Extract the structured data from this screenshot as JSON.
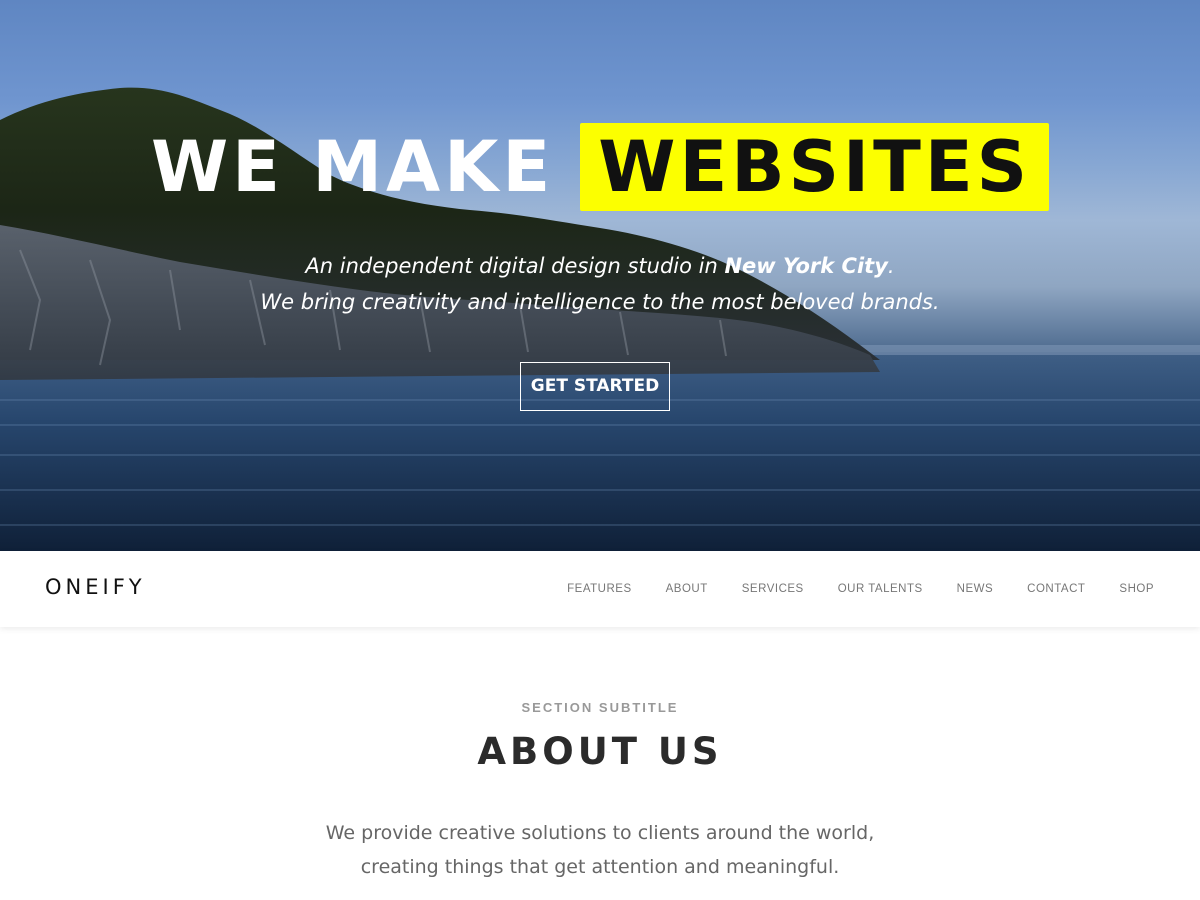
{
  "hero": {
    "headline_white": "WE MAKE",
    "headline_highlight": "WEBSITES",
    "highlight_color": "#fcff00",
    "tagline_line1_prefix": "An independent digital design studio in ",
    "tagline_line1_bold": "New York City",
    "tagline_line1_suffix": ".",
    "tagline_line2": "We bring creativity and intelligence to the most beloved brands.",
    "cta_label": "GET STARTED"
  },
  "nav": {
    "logo": "ONEIFY",
    "items": [
      {
        "label": "FEATURES"
      },
      {
        "label": "ABOUT"
      },
      {
        "label": "SERVICES"
      },
      {
        "label": "OUR TALENTS"
      },
      {
        "label": "NEWS"
      },
      {
        "label": "CONTACT"
      },
      {
        "label": "SHOP"
      }
    ]
  },
  "about": {
    "subtitle": "SECTION SUBTITLE",
    "title": "ABOUT US",
    "text_line1": "We provide creative solutions to clients around the world,",
    "text_line2": "creating things that get attention and meaningful."
  }
}
